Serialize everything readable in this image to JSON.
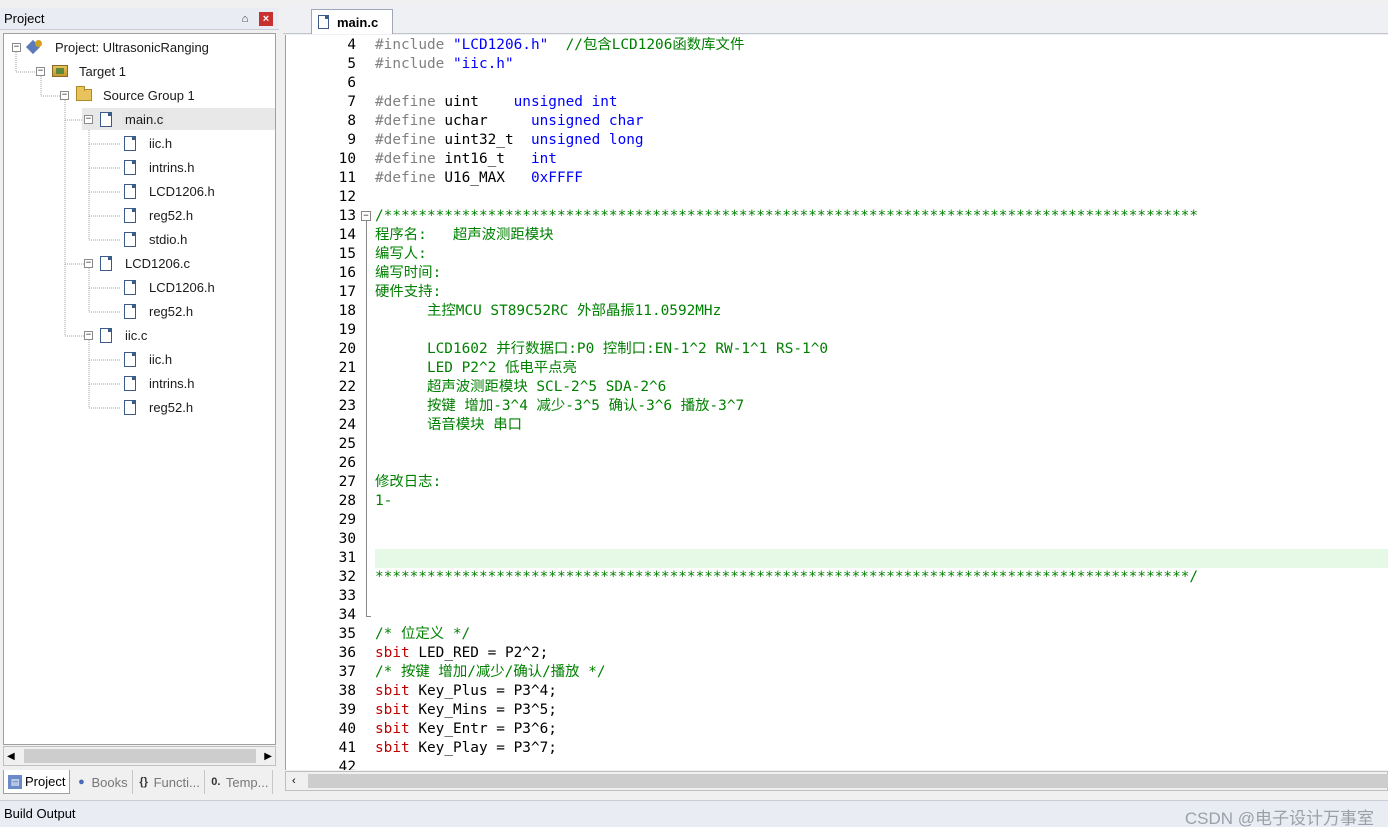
{
  "project_panel": {
    "title": "Project",
    "pin_glyph": "⌂",
    "close_glyph": "×",
    "tree": {
      "project": "Project: UltrasonicRanging",
      "target": "Target 1",
      "group": "Source Group 1",
      "main_c": "main.c",
      "main_deps": [
        "iic.h",
        "intrins.h",
        "LCD1206.h",
        "reg52.h",
        "stdio.h"
      ],
      "lcd_c": "LCD1206.c",
      "lcd_deps": [
        "LCD1206.h",
        "reg52.h"
      ],
      "iic_c": "iic.c",
      "iic_deps": [
        "iic.h",
        "intrins.h",
        "reg52.h"
      ]
    },
    "tabs": [
      {
        "label": "Project",
        "icon": "project-tab-icon"
      },
      {
        "label": "Books",
        "icon": "books-tab-icon"
      },
      {
        "label": "Functi...",
        "icon": "functions-tab-icon"
      },
      {
        "label": "Temp...",
        "icon": "templates-tab-icon"
      }
    ]
  },
  "editor": {
    "tab_label": "main.c",
    "highlight_line": 31,
    "lines": [
      {
        "n": "4",
        "segs": [
          [
            "pp",
            "#include "
          ],
          [
            "str",
            "\"LCD1206.h\""
          ],
          [
            "plain",
            "  "
          ],
          [
            "com",
            "//包含LCD1206函数库文件"
          ]
        ]
      },
      {
        "n": "5",
        "segs": [
          [
            "pp",
            "#include "
          ],
          [
            "str",
            "\"iic.h\""
          ]
        ]
      },
      {
        "n": "6",
        "segs": []
      },
      {
        "n": "7",
        "segs": [
          [
            "pp",
            "#define "
          ],
          [
            "plain",
            "uint    "
          ],
          [
            "kw",
            "unsigned int"
          ]
        ]
      },
      {
        "n": "8",
        "segs": [
          [
            "pp",
            "#define "
          ],
          [
            "plain",
            "uchar     "
          ],
          [
            "kw",
            "unsigned char"
          ]
        ]
      },
      {
        "n": "9",
        "segs": [
          [
            "pp",
            "#define "
          ],
          [
            "plain",
            "uint32_t  "
          ],
          [
            "kw",
            "unsigned long"
          ]
        ]
      },
      {
        "n": "10",
        "segs": [
          [
            "pp",
            "#define "
          ],
          [
            "plain",
            "int16_t   "
          ],
          [
            "kw",
            "int"
          ]
        ]
      },
      {
        "n": "11",
        "segs": [
          [
            "pp",
            "#define "
          ],
          [
            "plain",
            "U16_MAX   "
          ],
          [
            "kw",
            "0xFFFF"
          ]
        ]
      },
      {
        "n": "12",
        "segs": []
      },
      {
        "n": "13",
        "segs": [
          [
            "com",
            "/**********************************************************************************************"
          ]
        ]
      },
      {
        "n": "14",
        "segs": [
          [
            "com",
            "程序名:   超声波测距模块"
          ]
        ]
      },
      {
        "n": "15",
        "segs": [
          [
            "com",
            "编写人:"
          ]
        ]
      },
      {
        "n": "16",
        "segs": [
          [
            "com",
            "编写时间:"
          ]
        ]
      },
      {
        "n": "17",
        "segs": [
          [
            "com",
            "硬件支持:"
          ]
        ]
      },
      {
        "n": "18",
        "segs": [
          [
            "com",
            "      主控MCU ST89C52RC 外部晶振11.0592MHz"
          ]
        ]
      },
      {
        "n": "19",
        "segs": []
      },
      {
        "n": "20",
        "segs": [
          [
            "com",
            "      LCD1602 并行数据口:P0 控制口:EN-1^2 RW-1^1 RS-1^0"
          ]
        ]
      },
      {
        "n": "21",
        "segs": [
          [
            "com",
            "      LED P2^2 低电平点亮"
          ]
        ]
      },
      {
        "n": "22",
        "segs": [
          [
            "com",
            "      超声波测距模块 SCL-2^5 SDA-2^6"
          ]
        ]
      },
      {
        "n": "23",
        "segs": [
          [
            "com",
            "      按键 增加-3^4 减少-3^5 确认-3^6 播放-3^7"
          ]
        ]
      },
      {
        "n": "24",
        "segs": [
          [
            "com",
            "      语音模块 串口"
          ]
        ]
      },
      {
        "n": "25",
        "segs": []
      },
      {
        "n": "26",
        "segs": []
      },
      {
        "n": "27",
        "segs": [
          [
            "com",
            "修改日志:"
          ]
        ]
      },
      {
        "n": "28",
        "segs": [
          [
            "com",
            "1-"
          ]
        ]
      },
      {
        "n": "29",
        "segs": []
      },
      {
        "n": "30",
        "segs": []
      },
      {
        "n": "31",
        "segs": []
      },
      {
        "n": "32",
        "segs": [
          [
            "com",
            "**********************************************************************************************/"
          ]
        ]
      },
      {
        "n": "33",
        "segs": []
      },
      {
        "n": "34",
        "segs": []
      },
      {
        "n": "35",
        "segs": [
          [
            "com",
            "/* 位定义 */"
          ]
        ]
      },
      {
        "n": "36",
        "segs": [
          [
            "red",
            "sbit "
          ],
          [
            "plain",
            "LED_RED = P2^2;"
          ]
        ]
      },
      {
        "n": "37",
        "segs": [
          [
            "com",
            "/* 按键 增加/减少/确认/播放 */"
          ]
        ]
      },
      {
        "n": "38",
        "segs": [
          [
            "red",
            "sbit "
          ],
          [
            "plain",
            "Key_Plus = P3^4;"
          ]
        ]
      },
      {
        "n": "39",
        "segs": [
          [
            "red",
            "sbit "
          ],
          [
            "plain",
            "Key_Mins = P3^5;"
          ]
        ]
      },
      {
        "n": "40",
        "segs": [
          [
            "red",
            "sbit "
          ],
          [
            "plain",
            "Key_Entr = P3^6;"
          ]
        ]
      },
      {
        "n": "41",
        "segs": [
          [
            "red",
            "sbit "
          ],
          [
            "plain",
            "Key_Play = P3^7;"
          ]
        ]
      },
      {
        "n": "42",
        "segs": []
      }
    ]
  },
  "build_output": {
    "title": "Build Output",
    "watermark": "CSDN @电子设计万事室"
  }
}
